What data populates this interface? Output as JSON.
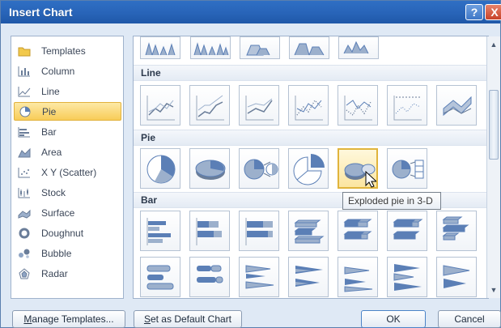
{
  "window": {
    "title": "Insert Chart",
    "help_glyph": "?",
    "close_glyph": "X"
  },
  "categories": [
    {
      "label": "Templates",
      "icon": "templates-folder-icon"
    },
    {
      "label": "Column",
      "icon": "column-chart-icon"
    },
    {
      "label": "Line",
      "icon": "line-chart-icon"
    },
    {
      "label": "Pie",
      "icon": "pie-chart-icon",
      "selected": true
    },
    {
      "label": "Bar",
      "icon": "bar-chart-icon"
    },
    {
      "label": "Area",
      "icon": "area-chart-icon"
    },
    {
      "label": "X Y (Scatter)",
      "icon": "scatter-chart-icon"
    },
    {
      "label": "Stock",
      "icon": "stock-chart-icon"
    },
    {
      "label": "Surface",
      "icon": "surface-chart-icon"
    },
    {
      "label": "Doughnut",
      "icon": "doughnut-chart-icon"
    },
    {
      "label": "Bubble",
      "icon": "bubble-chart-icon"
    },
    {
      "label": "Radar",
      "icon": "radar-chart-icon"
    }
  ],
  "gallery": {
    "sections": [
      {
        "title": "Line"
      },
      {
        "title": "Pie"
      },
      {
        "title": "Bar"
      }
    ],
    "selected_item": "Exploded pie in 3-D"
  },
  "tooltip": {
    "text": "Exploded pie in 3-D"
  },
  "buttons": {
    "manage_prefix": "M",
    "manage_rest": "anage Templates...",
    "default_prefix": "S",
    "default_rest": "et as Default Chart",
    "ok": "OK",
    "cancel": "Cancel"
  },
  "colors": {
    "accent_blue": "#2864b8",
    "selection_gold": "#f8cc58",
    "chart_blue": "#5b7fb6"
  }
}
